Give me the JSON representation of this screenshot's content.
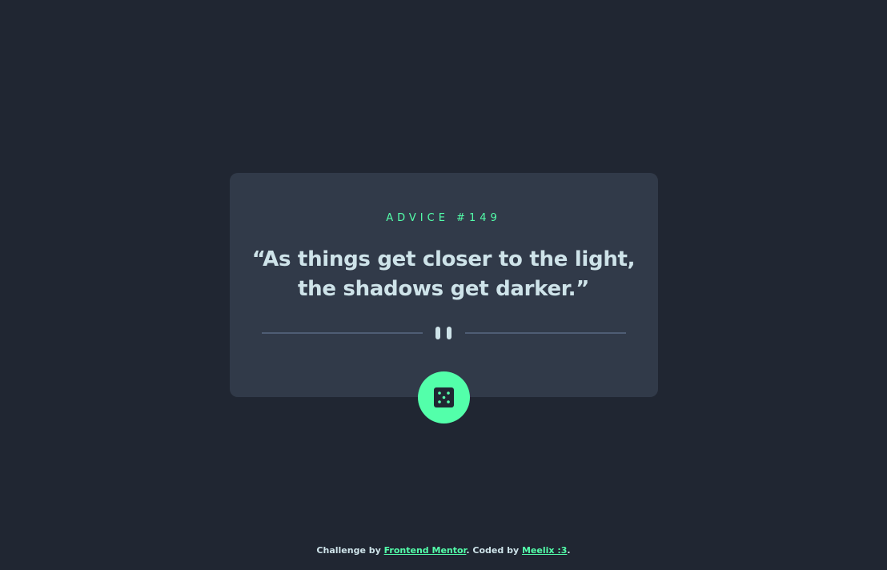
{
  "advice": {
    "label": "ADVICE #149",
    "quote": "“As things get closer to the light, the shadows get darker.”"
  },
  "divider": {
    "icon": "pause-icon"
  },
  "button": {
    "icon": "dice-icon"
  },
  "footer": {
    "prefix": "Challenge by ",
    "link1": "Frontend Mentor",
    "middle": ". Coded by ",
    "link2": "Meelix :3",
    "suffix": "."
  },
  "colors": {
    "background": "#202632",
    "card": "#313a49",
    "accent": "#53ffaa",
    "text": "#cee3e9",
    "divider": "#4f5d74"
  }
}
